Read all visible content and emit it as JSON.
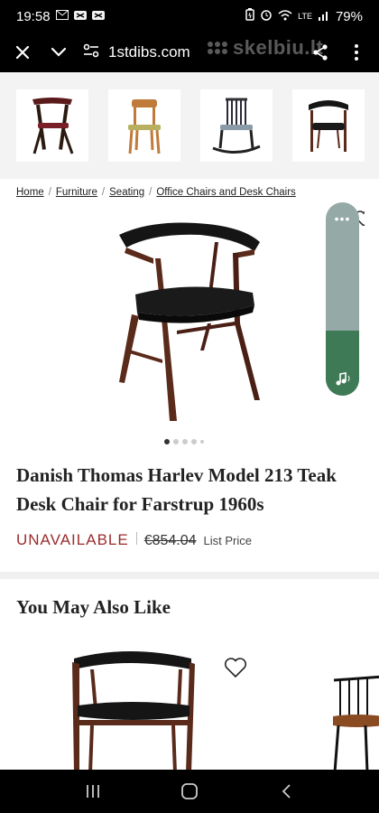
{
  "status": {
    "time": "19:58",
    "left_icons": [
      "gmail-icon",
      "notification-icon",
      "notification-icon"
    ],
    "right_icons": [
      "battery-saver-icon",
      "alarm-icon",
      "wifi-icon",
      "lte-icon",
      "signal-icon"
    ],
    "lte_label": "LTE",
    "battery": "79%"
  },
  "browser": {
    "domain": "1stdibs.com",
    "watermark": "skelbiu.lt"
  },
  "breadcrumb": {
    "home": "Home",
    "furniture": "Furniture",
    "seating": "Seating",
    "office": "Office Chairs and Desk Chairs",
    "separator": "/"
  },
  "product": {
    "title": "Danish Thomas Harlev Model 213 Teak Desk Chair for Farstrup 1960s",
    "availability": "UNAVAILABLE",
    "old_price": "€854.04",
    "price_label": "List Price",
    "image_dot_count": 5,
    "active_dot": 0
  },
  "float_panel": {
    "menu_glyph": "•••",
    "colors": {
      "top": "#95aaa7",
      "bottom": "#3d7a55"
    }
  },
  "recommendations": {
    "title": "You May Also Like"
  },
  "colors": {
    "unavailable": "#9b2b2b",
    "teak": "#5a2a1a",
    "leather": "#151515"
  }
}
